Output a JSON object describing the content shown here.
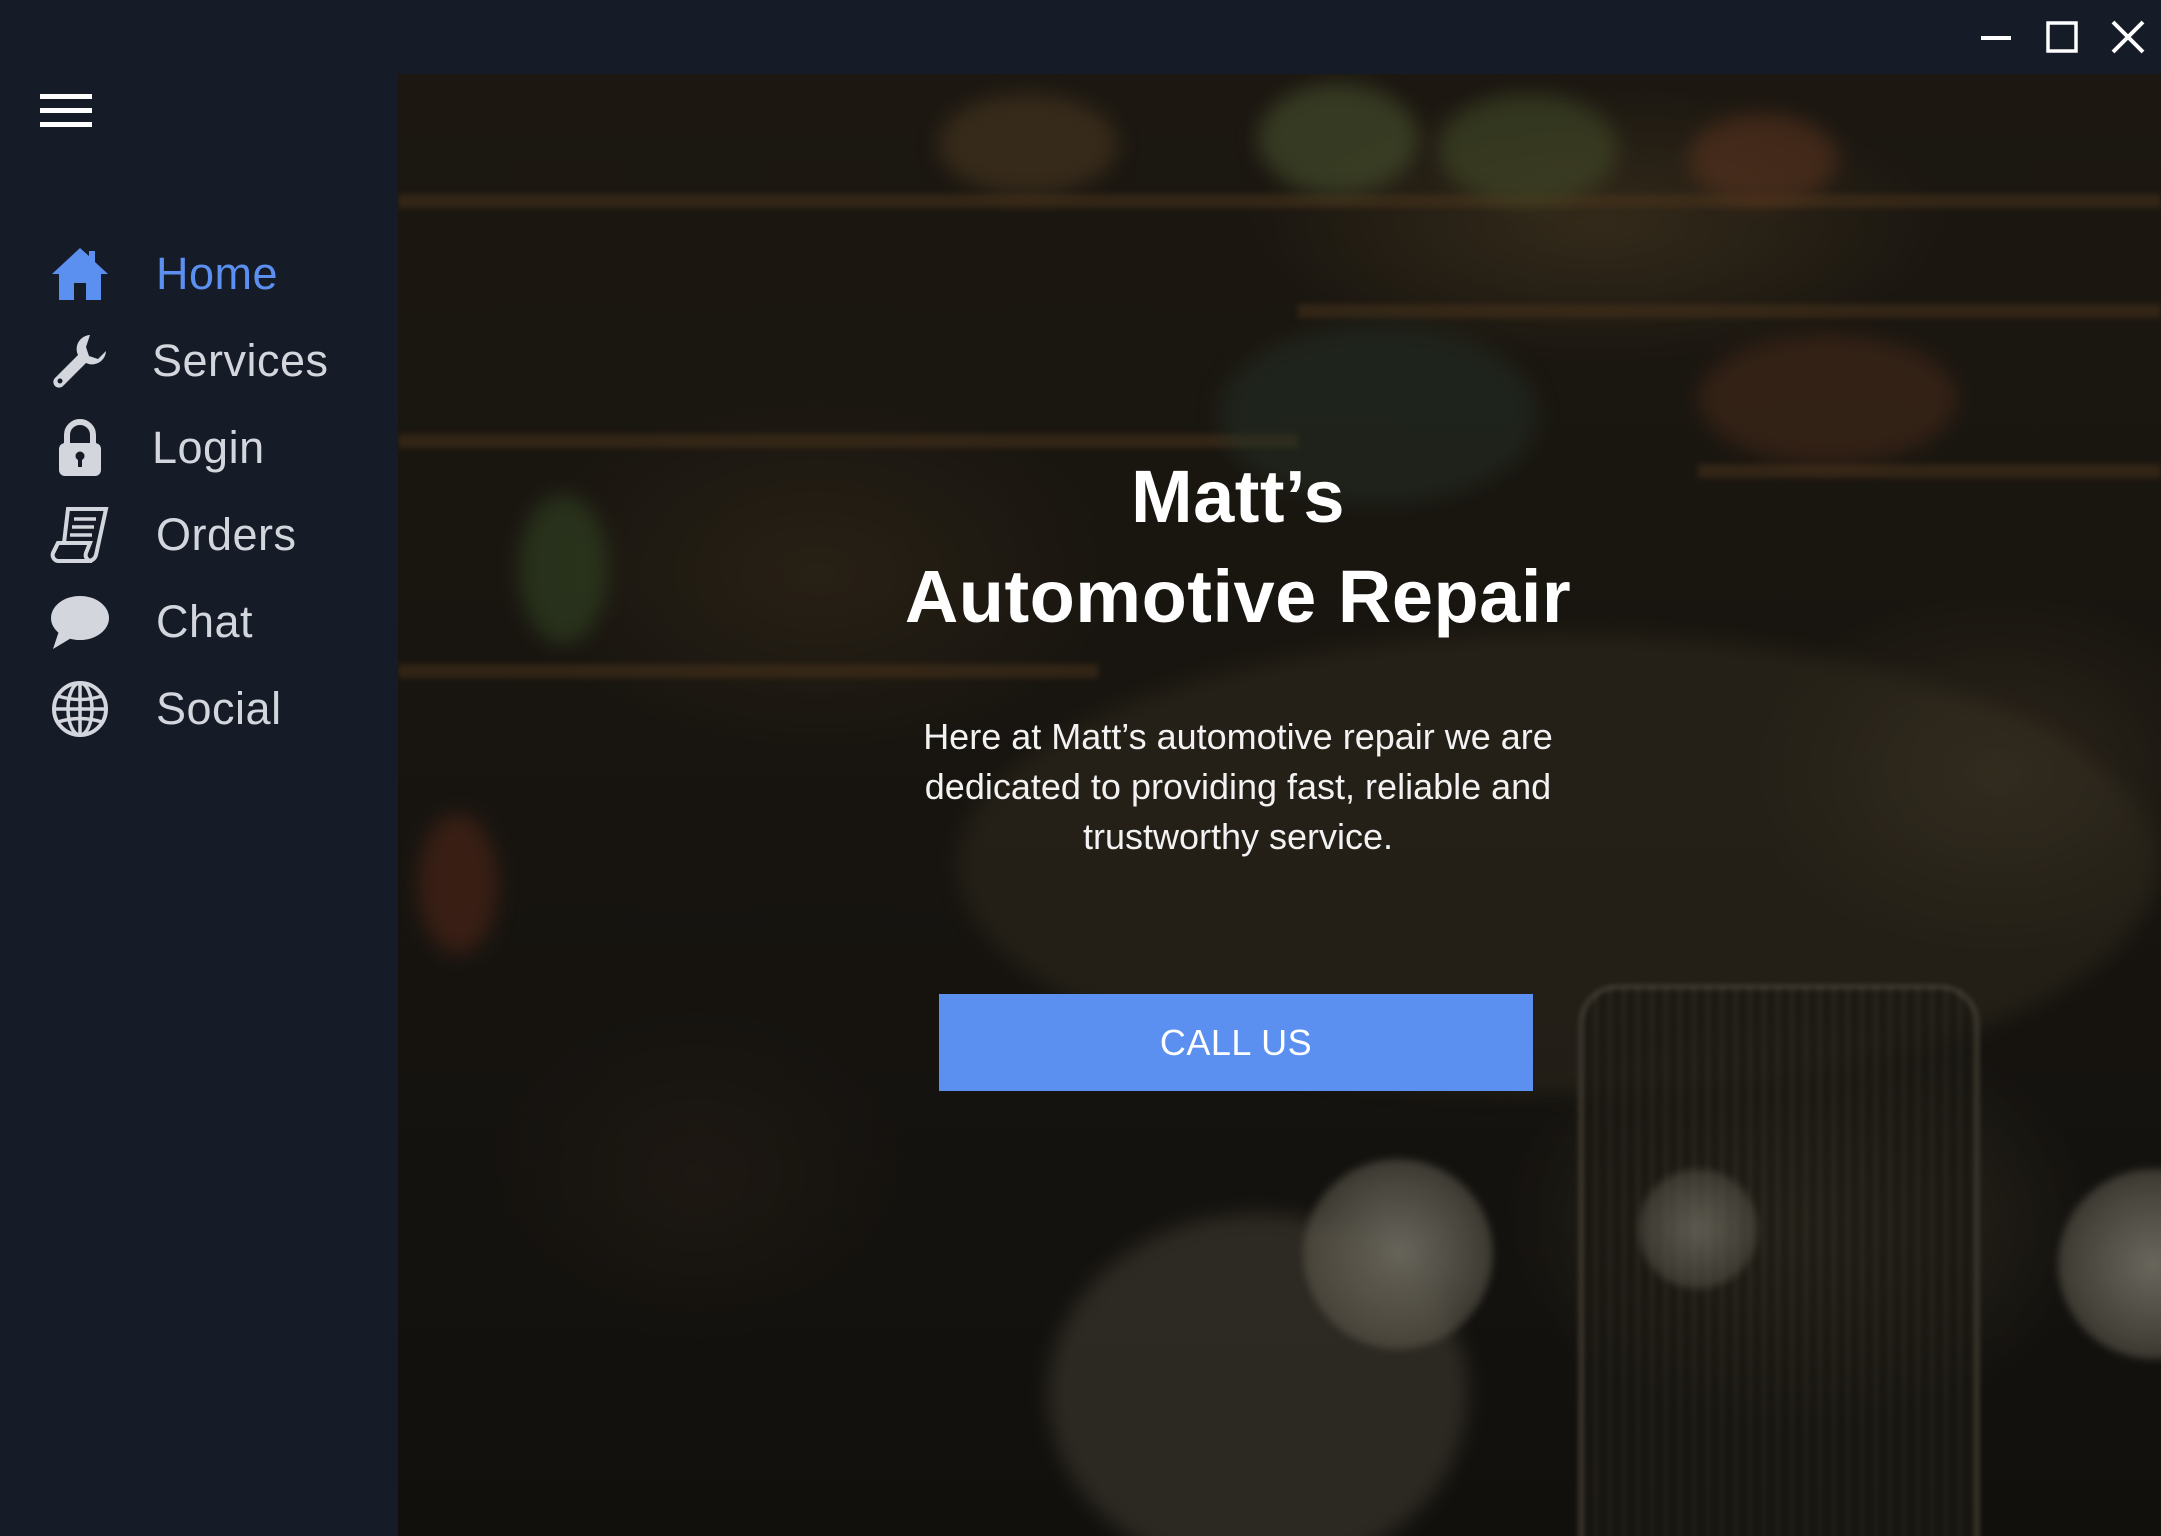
{
  "window": {
    "controls": [
      "minimize-icon",
      "maximize-icon",
      "close-icon"
    ]
  },
  "sidebar": {
    "menu_icon": "hamburger-menu-icon",
    "items": [
      {
        "label": "Home",
        "icon": "home-icon",
        "active": true
      },
      {
        "label": "Services",
        "icon": "wrench-icon",
        "active": false
      },
      {
        "label": "Login",
        "icon": "lock-icon",
        "active": false
      },
      {
        "label": "Orders",
        "icon": "receipt-icon",
        "active": false
      },
      {
        "label": "Chat",
        "icon": "chat-bubble-icon",
        "active": false
      },
      {
        "label": "Social",
        "icon": "globe-icon",
        "active": false
      }
    ]
  },
  "hero": {
    "title_line1": "Matt’s",
    "title_line2": "Automotive Repair",
    "description": "Here at Matt’s automotive repair we are dedicated to providing fast, reliable and trustworthy service.",
    "cta_label": "CALL US"
  },
  "colors": {
    "sidebar_bg": "#151b27",
    "accent": "#5b8ff0",
    "nav_text": "#d3d6dc",
    "title_text": "#ffffff"
  }
}
